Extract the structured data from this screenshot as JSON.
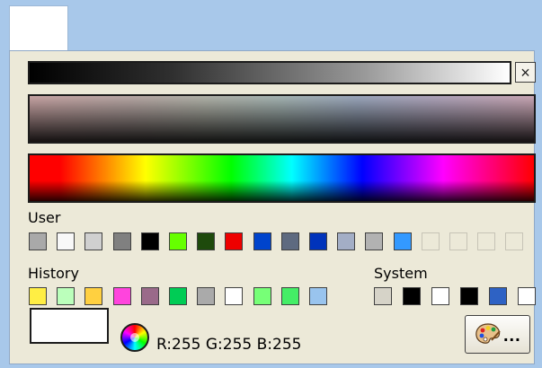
{
  "window": {
    "top_swatch_color": "#ffffff"
  },
  "colors": {
    "panel_background": "#ece9d8",
    "outer_background": "#a8c8ea"
  },
  "toolbar": {
    "close_glyph": "×"
  },
  "user": {
    "label": "User",
    "swatches": [
      "#a9a9a9",
      "#f8f8f8",
      "#d0d0d0",
      "#808080",
      "#000000",
      "#66ff00",
      "#1e4a0c",
      "#ee0000",
      "#0044cc",
      "#5e6a80",
      "#0033bb",
      "#a3aec6",
      "#b2b2b2",
      "#3399ff",
      "",
      "",
      "",
      ""
    ]
  },
  "history": {
    "label": "History",
    "swatches": [
      "#ffee44",
      "#bbffbb",
      "#ffd040",
      "#ff44dd",
      "#9a6a8a",
      "#00cc55",
      "#aaaaaa",
      "#ffffff",
      "#77ff77",
      "#44ee66",
      "#99c4ee"
    ]
  },
  "system": {
    "label": "System",
    "swatches": [
      "#d6d3c8",
      "#000000",
      "#ffffff",
      "#000000",
      "#2e62c4",
      "#ffffff"
    ]
  },
  "current": {
    "color": "#ffffff",
    "rgb_text": "R:255 G:255 B:255"
  },
  "palette_button": {
    "dots": "..."
  }
}
